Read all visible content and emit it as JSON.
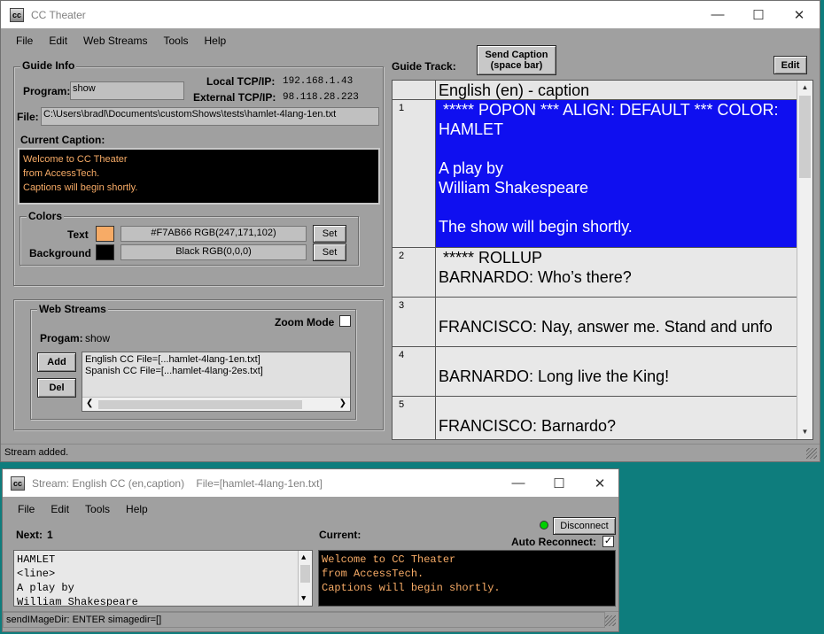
{
  "main_window": {
    "title": "CC Theater",
    "menu": [
      "File",
      "Edit",
      "Web Streams",
      "Tools",
      "Help"
    ],
    "guide_info": {
      "group_label": "Guide Info",
      "program_label": "Program:",
      "program_value": "show",
      "local_ip_label": "Local TCP/IP:",
      "local_ip_value": "192.168.1.43",
      "external_ip_label": "External TCP/IP:",
      "external_ip_value": "98.118.28.223",
      "file_label": "File:",
      "file_value": "C:\\Users\\bradl\\Documents\\customShows\\tests\\hamlet-4lang-1en.txt",
      "current_caption_label": "Current Caption:",
      "current_caption_lines": [
        "Welcome to CC Theater",
        "from AccessTech.",
        "Captions will begin shortly."
      ]
    },
    "colors": {
      "group_label": "Colors",
      "text_label": "Text",
      "text_swatch": "#F7AB66",
      "text_value": "#F7AB66   RGB(247,171,102)",
      "background_label": "Background",
      "background_swatch": "#000000",
      "background_value": "Black   RGB(0,0,0)",
      "set_label": "Set"
    },
    "web_streams": {
      "group_label": "Web Streams",
      "zoom_mode_label": "Zoom Mode",
      "progam_label": "Progam:",
      "progam_value": "show",
      "add_label": "Add",
      "del_label": "Del",
      "items": [
        "English CC File=[...hamlet-4lang-1en.txt]",
        "Spanish CC File=[...hamlet-4lang-2es.txt]"
      ]
    },
    "guide_track": {
      "label": "Guide Track:",
      "send_caption_label": "Send Caption",
      "send_caption_sub": "(space bar)",
      "edit_label": "Edit",
      "column_header": "English (en) - caption",
      "rows": [
        {
          "num": "1",
          "text": " ***** POPON *** ALIGN: DEFAULT *** COLOR: \nHAMLET\n\nA play by\nWilliam Shakespeare\n\nThe show will begin shortly.",
          "selected": true
        },
        {
          "num": "2",
          "text": " ***** ROLLUP\nBARNARDO: Who’s there?",
          "selected": false
        },
        {
          "num": "3",
          "text": "\nFRANCISCO: Nay, answer me. Stand and unfo",
          "selected": false
        },
        {
          "num": "4",
          "text": "\nBARNARDO: Long live the King!",
          "selected": false
        },
        {
          "num": "5",
          "text": "\nFRANCISCO: Barnardo?",
          "selected": false
        }
      ]
    },
    "status": "Stream added."
  },
  "stream_window": {
    "title": "Stream: English CC (en,caption)    File=[hamlet-4lang-1en.txt]",
    "menu": [
      "File",
      "Edit",
      "Tools",
      "Help"
    ],
    "next_label": "Next:",
    "next_value": "1",
    "current_label": "Current:",
    "disconnect_label": "Disconnect",
    "auto_reconnect_label": "Auto Reconnect:",
    "next_lines": [
      "HAMLET",
      "<line>",
      "A play by",
      "William Shakespeare"
    ],
    "current_lines": [
      "Welcome to CC Theater",
      "from AccessTech.",
      "Captions will begin shortly."
    ],
    "status": "sendIMageDir: ENTER simagedir=[]",
    "indicator_color": "#00d000"
  }
}
